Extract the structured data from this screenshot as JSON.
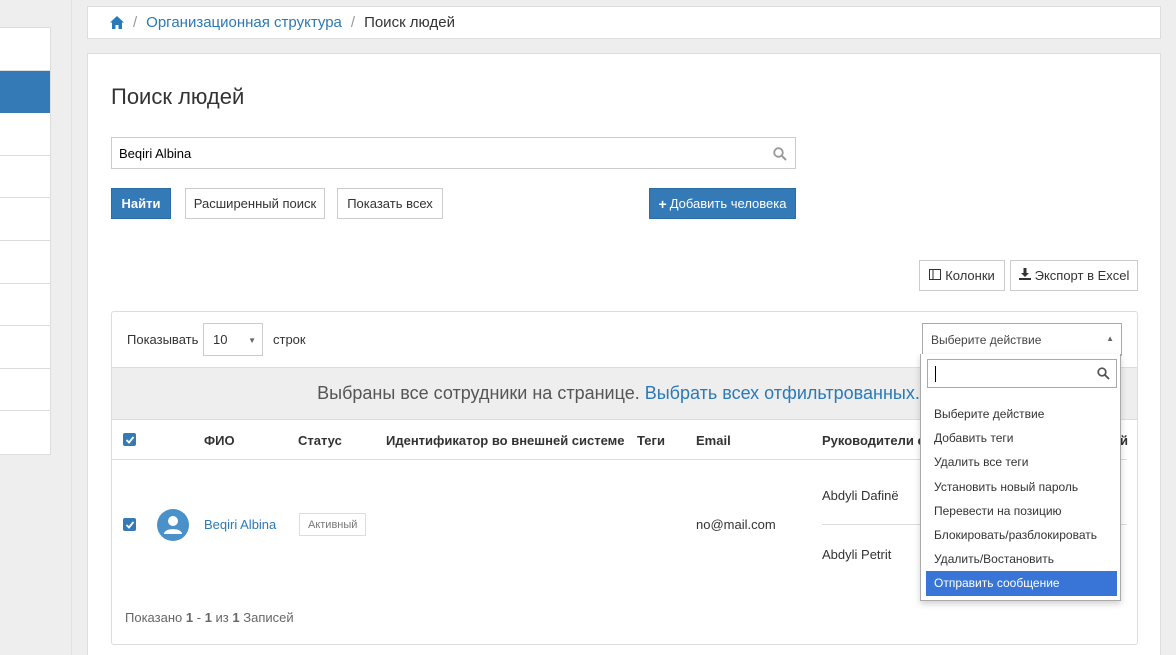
{
  "breadcrumb": {
    "home_icon": "home-icon",
    "items": [
      "Организационная структура",
      "Поиск людей"
    ]
  },
  "sidebar": {
    "active_index": 1
  },
  "page": {
    "title": "Поиск людей"
  },
  "search": {
    "value": "Beqiri Albina",
    "icon": "search-icon"
  },
  "buttons": {
    "find": "Найти",
    "advanced": "Расширенный поиск",
    "show_all": "Показать всех",
    "add_person": "Добавить человека",
    "columns": "Колонки",
    "export": "Экспорт в Excel"
  },
  "table_controls": {
    "show_label": "Показывать",
    "rows_value": "10",
    "rows_suffix": "строк",
    "action_select": "Выберите действие"
  },
  "banner": {
    "text": "Выбраны все сотрудники на странице.",
    "link": "Выбрать всех отфильтрованных."
  },
  "table": {
    "headers": {
      "name": "ФИО",
      "status": "Статус",
      "external_id": "Идентификатор во внешней системе",
      "tags": "Теги",
      "email": "Email",
      "managers": "Руководители с",
      "last_partial": "й"
    },
    "rows": [
      {
        "name": "Beqiri Albina",
        "status": "Активный",
        "email": "no@mail.com",
        "managers": [
          "Abdyli Dafinë",
          "Abdyli Petrit"
        ]
      }
    ]
  },
  "footer": {
    "prefix": "Показано",
    "from": "1",
    "dash": "-",
    "to": "1",
    "of_word": "из",
    "total": "1",
    "suffix": "Записей"
  },
  "dropdown": {
    "search_value": "",
    "highlighted_index": 7,
    "options": [
      "Выберите действие",
      "Добавить теги",
      "Удалить все теги",
      "Установить новый пароль",
      "Перевести на позицию",
      "Блокировать/разблокировать",
      "Удалить/Востановить",
      "Отправить сообщение"
    ]
  },
  "colors": {
    "primary": "#337ab7",
    "link": "#2a7ab8",
    "highlight": "#3875d7",
    "background": "#eeeeee"
  }
}
